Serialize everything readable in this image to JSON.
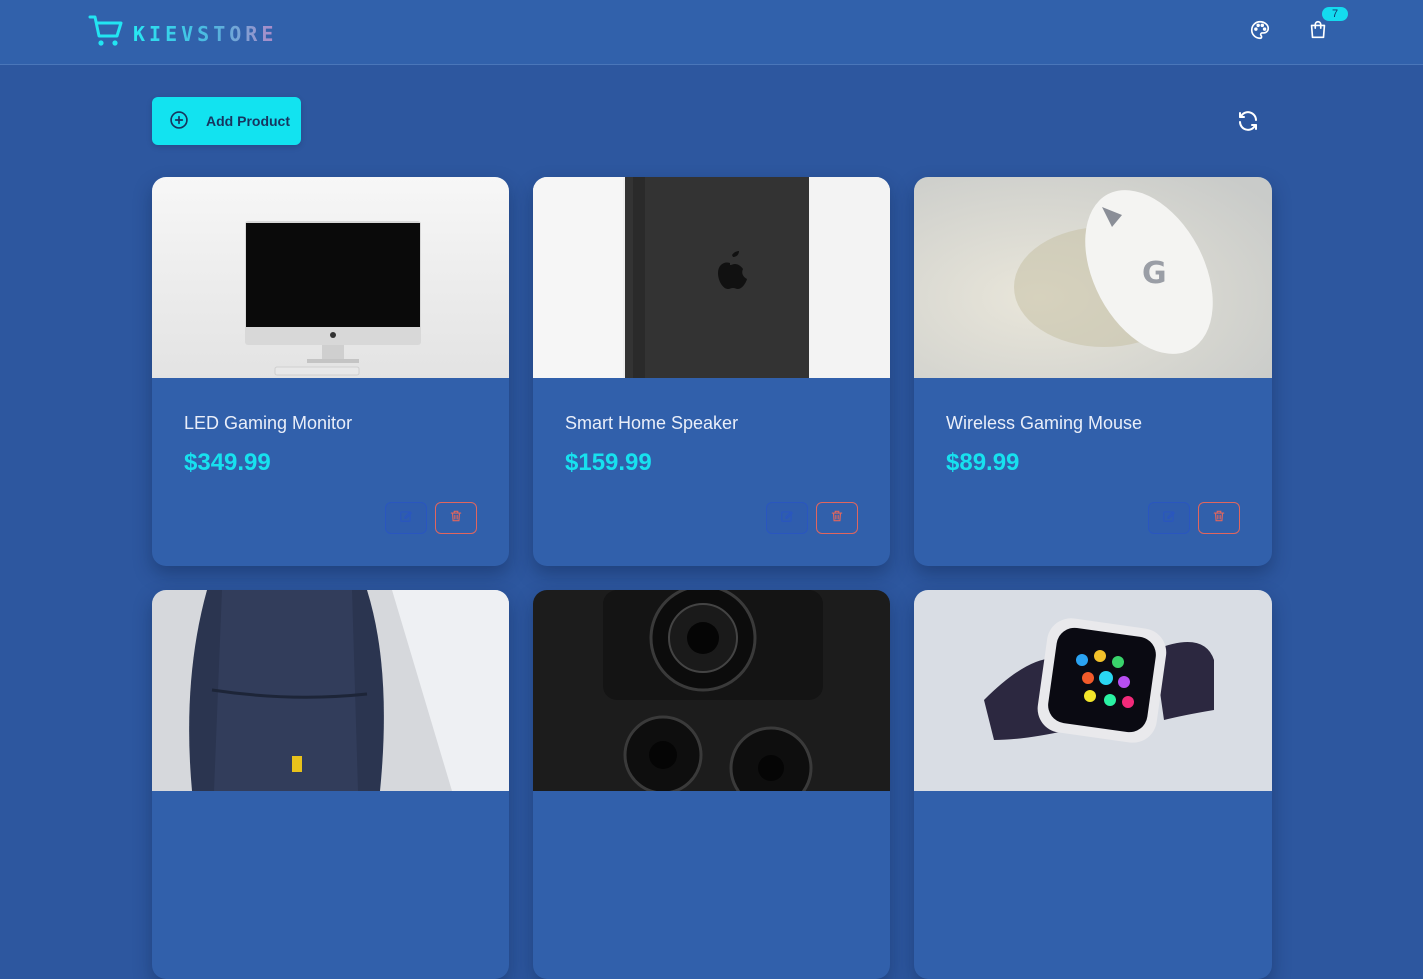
{
  "brand": {
    "name": "KIEVSTORE"
  },
  "header": {
    "cart_count": "7"
  },
  "toolbar": {
    "add_label": "Add Product"
  },
  "products": [
    {
      "title": "LED Gaming Monitor",
      "price": "$349.99"
    },
    {
      "title": "Smart Home Speaker",
      "price": "$159.99"
    },
    {
      "title": "Wireless Gaming Mouse",
      "price": "$89.99"
    },
    {
      "title": "",
      "price": ""
    },
    {
      "title": "",
      "price": ""
    },
    {
      "title": "",
      "price": ""
    }
  ],
  "colors": {
    "background": "#2d579f",
    "header": "#3161ab",
    "accent": "#12e3f0",
    "price": "#17e1ef",
    "danger": "#e0665e"
  },
  "icons": {
    "logo": "shopping-cart-icon",
    "theme": "palette-icon",
    "cart": "shopping-bag-icon",
    "add": "plus-circle-icon",
    "refresh": "refresh-icon",
    "edit": "edit-icon",
    "delete": "trash-icon"
  }
}
